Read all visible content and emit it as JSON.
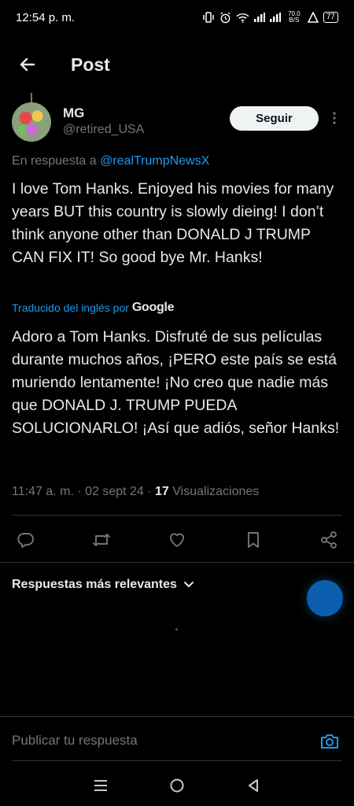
{
  "status_bar": {
    "time": "12:54 p. m.",
    "net_speed": "70.0 B/S",
    "battery": "77"
  },
  "header": {
    "title": "Post"
  },
  "tweet": {
    "author": {
      "display_name": "MG",
      "handle": "@retired_USA"
    },
    "follow_label": "Seguir",
    "reply_prefix": "En respuesta a ",
    "reply_mention": "@realTrumpNewsX",
    "text": "I love Tom Hanks. Enjoyed his movies for many years BUT this country is slowly dieing! I don’t think anyone other than DONALD J TRUMP CAN FIX IT! So good bye Mr. Hanks!",
    "translated_by": "Traducido del inglés por",
    "translated_provider": "Google",
    "translation": "Adoro a Tom Hanks. Disfruté de sus películas durante muchos años, ¡PERO este país se está muriendo lentamente! ¡No creo que nadie más que DONALD J. TRUMP PUEDA SOLUCIONARLO! ¡Así que adiós, señor Hanks!",
    "timestamp": "11:47 a. m. · 02 sept 24 · ",
    "views_count": "17",
    "views_label": " Visualizaciones"
  },
  "replies": {
    "sort_label": "Respuestas más relevantes"
  },
  "compose": {
    "placeholder": "Publicar tu respuesta"
  },
  "icons": {
    "back": "arrow-left-icon",
    "more": "more-vertical-icon",
    "reply": "reply-icon",
    "retweet": "retweet-icon",
    "like": "heart-icon",
    "bookmark": "bookmark-icon",
    "share": "share-icon",
    "camera": "camera-icon"
  },
  "colors": {
    "background": "#000000",
    "text": "#e7e9ea",
    "muted": "#71767b",
    "accent": "#1d9bf0",
    "divider": "#2f3336"
  }
}
